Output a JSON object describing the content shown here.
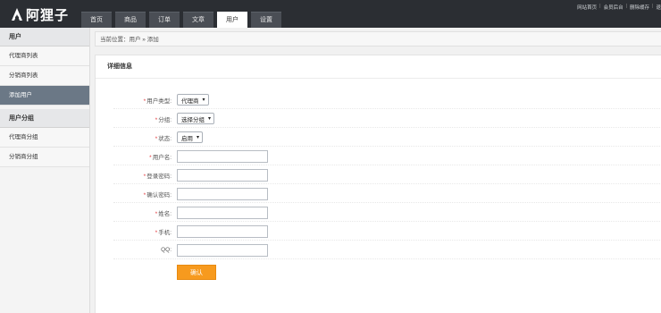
{
  "brand": {
    "name": "阿狸子",
    "logo_icon": "logo-a-icon"
  },
  "nav": {
    "tabs": [
      {
        "label": "首页",
        "active": false
      },
      {
        "label": "商品",
        "active": false
      },
      {
        "label": "订单",
        "active": false
      },
      {
        "label": "文章",
        "active": false
      },
      {
        "label": "用户",
        "active": true
      },
      {
        "label": "设置",
        "active": false
      }
    ]
  },
  "toplinks": {
    "site_home": "网站首页",
    "member_center": "会员后台",
    "clear_cache": "删除缓存",
    "logout": "退",
    "separator": "|"
  },
  "sidebar": {
    "group1_title": "用户",
    "group1_items": [
      {
        "label": "代理商列表",
        "active": false
      },
      {
        "label": "分销商列表",
        "active": false
      },
      {
        "label": "添加用户",
        "active": true
      }
    ],
    "group2_title": "用户分组",
    "group2_items": [
      {
        "label": "代理商分组",
        "active": false
      },
      {
        "label": "分销商分组",
        "active": false
      }
    ]
  },
  "breadcrumb": {
    "text": "当前位置：用户 » 添加"
  },
  "panel": {
    "title": "详细信息"
  },
  "form": {
    "required_mark": "*",
    "user_type": {
      "label": "用户类型:",
      "value": "代理商"
    },
    "group": {
      "label": "分组:",
      "value": "选择分组"
    },
    "status": {
      "label": "状态:",
      "value": "启用"
    },
    "username": {
      "label": "用户名:"
    },
    "login_password": {
      "label": "登录密码:"
    },
    "confirm_password": {
      "label": "确认密码:"
    },
    "name": {
      "label": "姓名:"
    },
    "phone": {
      "label": "手机:"
    },
    "qq": {
      "label": "QQ:"
    },
    "submit_label": "确认"
  },
  "colors": {
    "topbar": "#2b2e33",
    "active_sidebar": "#6b7886",
    "submit": "#f79a1e",
    "required": "#e4393c"
  }
}
